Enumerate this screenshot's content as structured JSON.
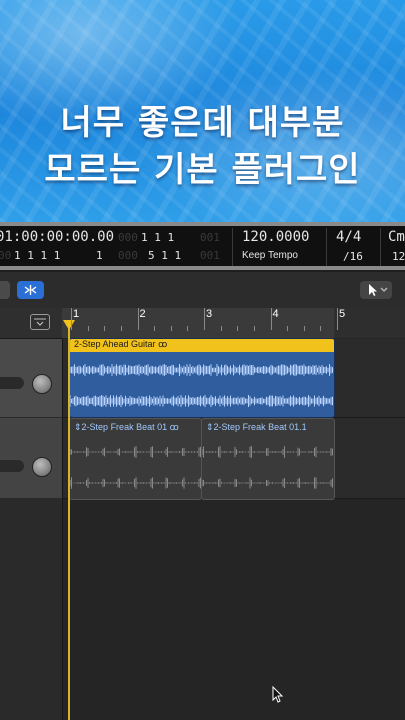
{
  "banner": {
    "line1": "너무 좋은데 대부분",
    "line2": "모르는 기본 플러그인"
  },
  "lcd": {
    "time": "01:00:00:00.00",
    "position_dim": "000",
    "bar_top": "1  1  1",
    "bar_top_dim": "001",
    "bar_bottom_left": "1  1  1  1",
    "bar_bottom_left_dim": "00",
    "bar_bottom_left_end": "1",
    "bar_bottom_right_dim": "000",
    "bar_bottom_right": "5  1  1",
    "bar_bottom_right_end": "001",
    "tempo": "120.0000",
    "tempo_mode": "Keep Tempo",
    "signature": "4/4",
    "division": "/16",
    "key": "Cm",
    "key_bottom": "12"
  },
  "ruler": {
    "bars": [
      "1",
      "2",
      "3",
      "4",
      "5"
    ]
  },
  "regions": {
    "guitar": {
      "name": "2-Step Ahead Guitar",
      "loop_icon": "ꝏ"
    },
    "beat1": {
      "name": "2-Step Freak Beat 01",
      "loop_icon": "ꝏ"
    },
    "beat2": {
      "name": "2-Step Freak Beat 01.1"
    }
  },
  "colors": {
    "banner_blue": "#1d86dc",
    "region_guitar": "#2f5d9e",
    "region_title_yellow": "#f0c21b",
    "snap_button": "#2a6fd6",
    "beat_region_text": "#9fc8ff"
  },
  "icons": {
    "snap": "snap-icon",
    "region_toggle": "region-toggle-icon",
    "pointer_tool": "pointer-tool-icon",
    "dropdown": "chevron-down-icon",
    "cursor": "mouse-cursor-icon"
  }
}
